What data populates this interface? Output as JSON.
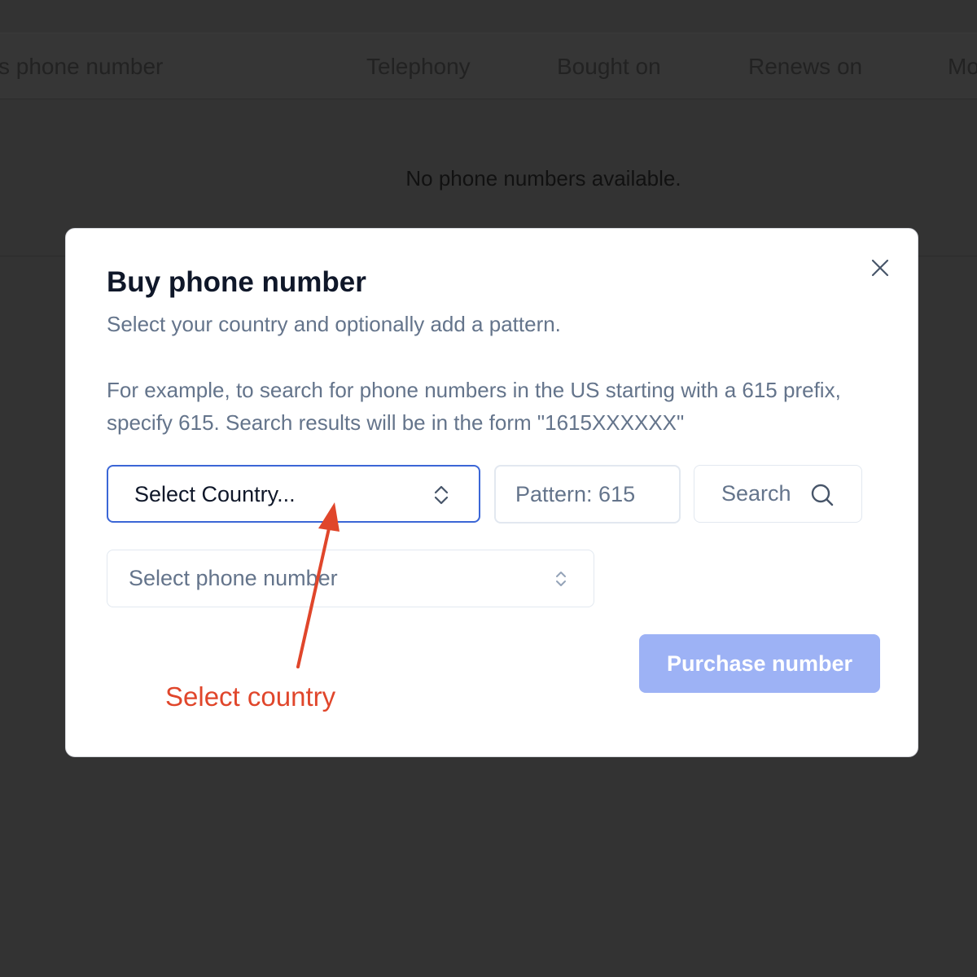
{
  "table": {
    "columns": [
      "s phone number",
      "Telephony",
      "Bought on",
      "Renews on",
      "Mo"
    ],
    "empty_message": "No phone numbers available."
  },
  "modal": {
    "title": "Buy phone number",
    "subtitle": "Select your country and optionally add a pattern.",
    "description": "For example, to search for phone numbers in the US starting with a 615 prefix, specify 615. Search results will be in the form \"1615XXXXXX\"",
    "country_select": {
      "label": "Select Country..."
    },
    "pattern_input": {
      "value": "",
      "placeholder": "Pattern: 615"
    },
    "search_button": {
      "label": "Search",
      "icon": "search-icon"
    },
    "phone_select": {
      "label": "Select phone number"
    },
    "purchase_button": {
      "label": "Purchase number"
    },
    "close_icon": "close-icon"
  },
  "annotation": {
    "text": "Select country",
    "color": "#e0462b"
  },
  "colors": {
    "accent": "#3b66d6",
    "purchase_disabled": "#9db2f5",
    "muted_text": "#64748b",
    "overlay": "#333333"
  }
}
